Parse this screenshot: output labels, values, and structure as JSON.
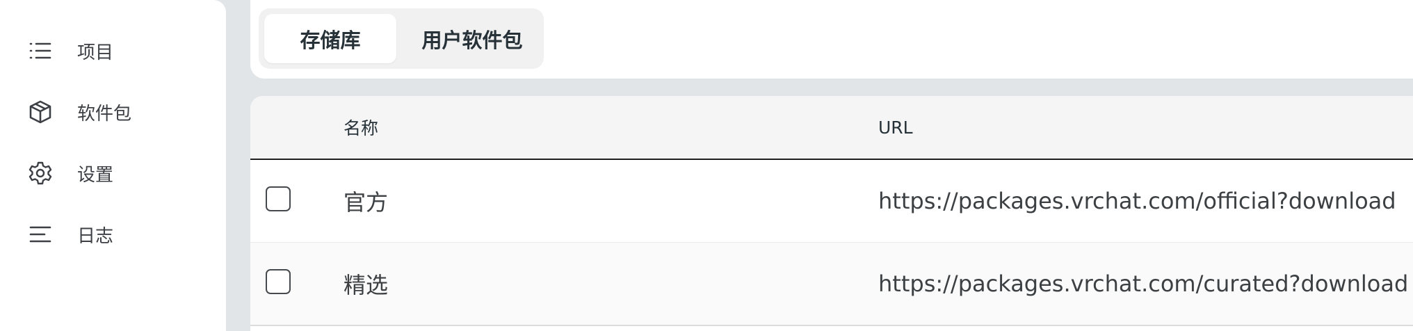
{
  "sidebar": {
    "items": [
      {
        "label": "项目",
        "icon": "list-icon"
      },
      {
        "label": "软件包",
        "icon": "package-icon"
      },
      {
        "label": "设置",
        "icon": "gear-icon"
      },
      {
        "label": "日志",
        "icon": "log-lines-icon"
      }
    ]
  },
  "tabs": [
    {
      "label": "存储库",
      "active": true
    },
    {
      "label": "用户软件包",
      "active": false
    }
  ],
  "table": {
    "headers": {
      "name": "名称",
      "url": "URL"
    },
    "rows": [
      {
        "checked": false,
        "name": "官方",
        "url": "https://packages.vrchat.com/official?download"
      },
      {
        "checked": false,
        "name": "精选",
        "url": "https://packages.vrchat.com/curated?download"
      }
    ]
  },
  "colors": {
    "background": "#e2e5e8",
    "surface": "#ffffff",
    "header_bg": "#f5f5f6",
    "text": "#263238"
  }
}
